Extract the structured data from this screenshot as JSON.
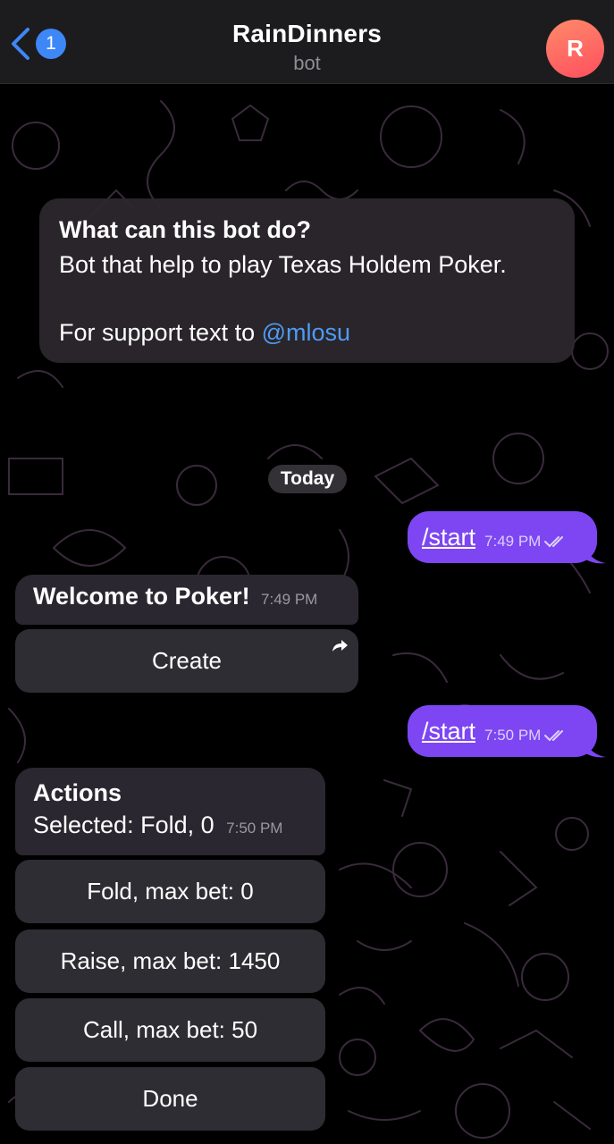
{
  "header": {
    "back_count": "1",
    "title": "RainDinners",
    "subtitle": "bot",
    "avatar_letter": "R"
  },
  "info": {
    "question": "What can this bot do?",
    "description": "Bot that help to play Texas Holdem Poker.",
    "support_prefix": "For support text to ",
    "support_handle": "@mlosu"
  },
  "date_pill": "Today",
  "messages": [
    {
      "command": "/start",
      "time": "7:49 PM"
    },
    {
      "text": "Welcome to Poker!",
      "time": "7:49 PM",
      "button": "Create"
    },
    {
      "command": "/start",
      "time": "7:50 PM"
    },
    {
      "title": "Actions",
      "text": "Selected: Fold, 0",
      "time": "7:50 PM",
      "buttons": [
        "Fold, max bet: 0",
        "Raise, max bet: 1450",
        "Call, max bet: 50",
        "Done"
      ]
    }
  ],
  "colors": {
    "accent": "#3e87f7",
    "outgoing": "#7d46f2",
    "incoming": "#2b2730",
    "link": "#4e9bf5"
  }
}
